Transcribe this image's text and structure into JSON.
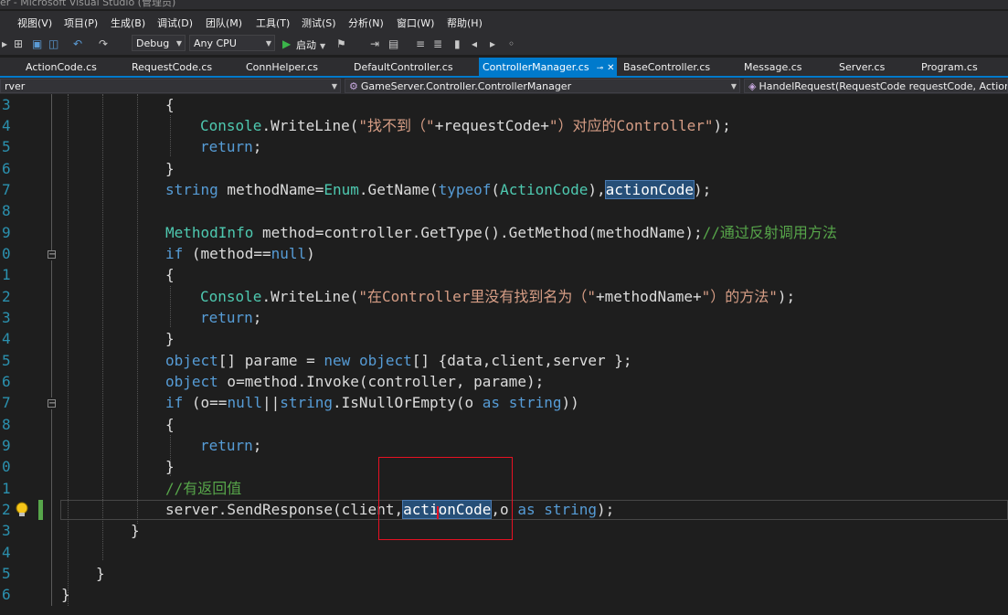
{
  "window": {
    "title": "er - Microsoft Visual Studio (管理员)"
  },
  "menu": [
    "视图(V)",
    "项目(P)",
    "生成(B)",
    "调试(D)",
    "团队(M)",
    "工具(T)",
    "测试(S)",
    "分析(N)",
    "窗口(W)",
    "帮助(H)"
  ],
  "toolbar": {
    "config": "Debug",
    "platform": "Any CPU",
    "start_label": "启动",
    "icons": [
      "new-project-icon",
      "open-icon",
      "save-icon",
      "save-all-icon",
      "undo-icon",
      "redo-icon",
      "start-icon",
      "attach-icon",
      "step-icon",
      "bookmark-icon"
    ]
  },
  "tabs": [
    "ActionCode.cs",
    "RequestCode.cs",
    "ConnHelper.cs",
    "DefaultController.cs",
    "ControllerManager.cs",
    "BaseController.cs",
    "Message.cs",
    "Server.cs",
    "Program.cs"
  ],
  "active_tab_index": 4,
  "nav": {
    "project": "rver",
    "class": "GameServer.Controller.ControllerManager",
    "member": "HandelRequest(RequestCode requestCode, ActionCode"
  },
  "line_numbers": [
    "3",
    "4",
    "5",
    "6",
    "7",
    "8",
    "9",
    "0",
    "1",
    "2",
    "3",
    "4",
    "5",
    "6",
    "7",
    "8",
    "9",
    "0",
    "1",
    "2",
    "3",
    "4",
    "5",
    "6"
  ],
  "colors": {
    "accent": "#007acc",
    "keyword": "#569cd6",
    "type": "#4ec9b0",
    "string": "#d69d85",
    "comment": "#57a64a",
    "highlight_box": "#e81123"
  }
}
